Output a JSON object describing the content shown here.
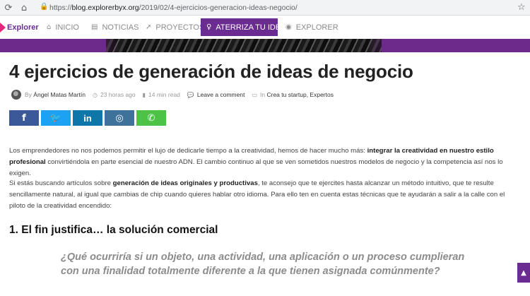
{
  "browser": {
    "url_prefix": "https://",
    "url_host": "blog.explorerbyx.org",
    "url_path": "/2019/02/4-ejercicios-generacion-ideas-negocio/",
    "back_icon": "refresh-icon",
    "home_icon": "home-icon",
    "lock_icon": "lock-icon",
    "star_icon": "star-icon"
  },
  "site": {
    "logo_text": "Explorer",
    "brand_color": "#6b2c91",
    "accent_color": "#e6267a",
    "nav": [
      {
        "label": "INICIO",
        "icon": "home-icon",
        "active": false
      },
      {
        "label": "NOTICIAS",
        "icon": "newspaper-icon",
        "active": false
      },
      {
        "label": "PROYECTOS",
        "icon": "rocket-icon",
        "active": false
      },
      {
        "label": "ATERRIZA TU IDEA",
        "icon": "lightbulb-icon",
        "active": true
      },
      {
        "label": "EXPLORER",
        "icon": "compass-icon",
        "active": false
      }
    ]
  },
  "article": {
    "title": "4 ejercicios de generación de ideas de negocio",
    "meta": {
      "by": "By",
      "author": "Ángel Matas Martín",
      "time": "23 horas ago",
      "read_time": "14 min read",
      "comments": "Leave a comment",
      "in": "In",
      "categories": "Crea tu startup, Expertos"
    },
    "share": [
      {
        "network": "facebook",
        "glyph": "f",
        "color": "#3b5998"
      },
      {
        "network": "twitter",
        "glyph": "🐦",
        "color": "#1da1f2"
      },
      {
        "network": "linkedin",
        "glyph": "in",
        "color": "#0e76a8"
      },
      {
        "network": "instagram",
        "glyph": "◎",
        "color": "#3f729b"
      },
      {
        "network": "whatsapp",
        "glyph": "✆",
        "color": "#4dc247"
      }
    ],
    "p1_a": "Los emprendedores no nos podemos permitir el lujo de dedicarle tiempo a la creatividad, hemos de hacer mucho más: ",
    "p1_b": "integrar la creatividad en nuestro estilo profesional",
    "p1_c": " convirtiéndola en parte esencial de nuestro ADN. El cambio continuo al que se ven sometidos nuestros modelos de negocio y la competencia así nos lo exigen.",
    "p2_a": "Si estás buscando artículos sobre ",
    "p2_b": "generación de ideas originales y productivas",
    "p2_c": ", te aconsejo que te ejercites hasta alcanzar un método intuitivo, que te resulte sencillamente natural, al igual que cambias de chip cuando quieres hablar otro idioma. Para ello ten en cuenta estas técnicas que te ayudarán a salir a la calle con el piloto de la creatividad encendido:",
    "h2": "1. El fin justifica… la solución comercial",
    "quote": "¿Qué ocurriría si un objeto, una actividad, una aplicación o un proceso cumplieran con una finalidad totalmente diferente a la que tienen asignada comúnmente?"
  }
}
